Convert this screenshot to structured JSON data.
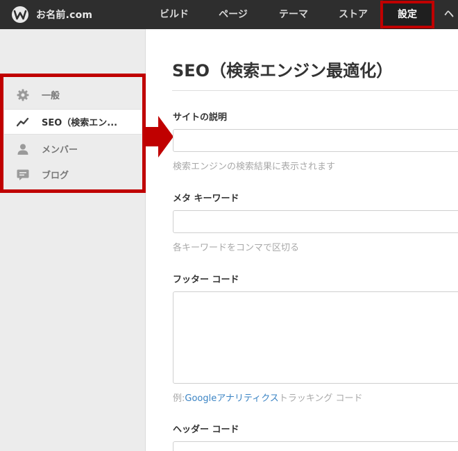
{
  "header": {
    "brand": "お名前.com",
    "nav": [
      {
        "label": "ビルド"
      },
      {
        "label": "ページ"
      },
      {
        "label": "テーマ"
      },
      {
        "label": "ストア"
      },
      {
        "label": "設定"
      },
      {
        "label": "ヘ"
      }
    ]
  },
  "sidebar": {
    "items": [
      {
        "label": "一般",
        "icon": "gear-icon"
      },
      {
        "label": "SEO（検索エン...",
        "icon": "trend-icon"
      },
      {
        "label": "メンバー",
        "icon": "user-icon"
      },
      {
        "label": "ブログ",
        "icon": "comment-icon"
      }
    ]
  },
  "main": {
    "title": "SEO（検索エンジン最適化）",
    "fields": {
      "site_description": {
        "label": "サイトの説明",
        "value": "",
        "hint": "検索エンジンの検索結果に表示されます"
      },
      "meta_keywords": {
        "label": "メタ キーワード",
        "value": "",
        "hint": "各キーワードをコンマで区切る"
      },
      "footer_code": {
        "label": "フッター コード",
        "value": "",
        "hint_prefix": "例:",
        "hint_link": "Googleアナリティクス",
        "hint_suffix": "トラッキング コード"
      },
      "header_code": {
        "label": "ヘッダー コード"
      }
    }
  },
  "colors": {
    "topbar": "#2e2e2e",
    "highlight": "#c00000",
    "link": "#3b84c4"
  }
}
